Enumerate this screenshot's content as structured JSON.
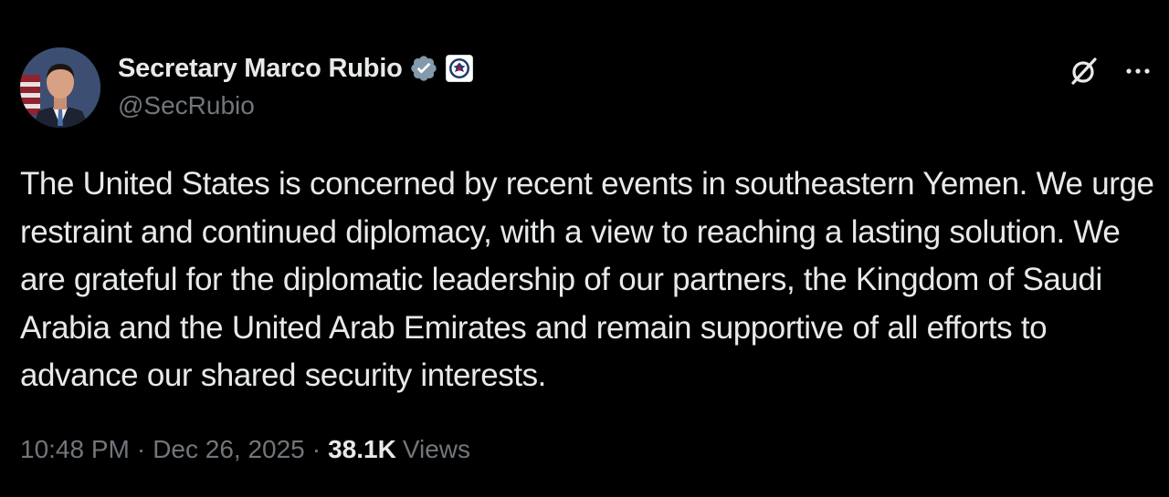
{
  "author": {
    "display_name": "Secretary Marco Rubio",
    "handle": "@SecRubio",
    "avatar_icon": "profile-photo",
    "verified_icon": "verified-badge-icon",
    "affiliate_icon": "department-of-state-seal-icon"
  },
  "actions": {
    "grok_icon": "grok-icon",
    "more_icon": "more-icon"
  },
  "tweet": {
    "text": "The United States is concerned by recent events in southeastern Yemen. We urge restraint and continued diplomacy, with a view to reaching a lasting solution. We are grateful for the diplomatic leadership of our partners, the Kingdom of Saudi Arabia and the United Arab Emirates and remain supportive of all efforts to advance our shared security interests.",
    "time": "10:48 PM",
    "date": "Dec 26, 2025",
    "separator": "·",
    "views_count": "38.1K",
    "views_label": "Views"
  },
  "colors": {
    "background": "#000000",
    "primary_text": "#e7e9ea",
    "secondary_text": "#71767b",
    "verified_badge": "#829aab"
  }
}
